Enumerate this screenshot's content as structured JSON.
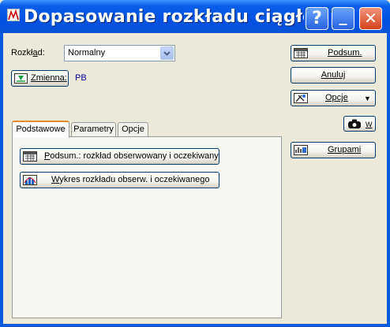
{
  "window": {
    "title": "Dopasowanie rozkładu ciągłego: /",
    "help_symbol": "?",
    "minimize_symbol": "_",
    "close_symbol": "✕"
  },
  "distribution": {
    "label_prefix": "Rozkł",
    "label_hotkey": "a",
    "label_suffix": "d:",
    "selected": "Normalny"
  },
  "variable": {
    "button_label": "Zmienna:",
    "value": "PB"
  },
  "tabs": [
    {
      "label": "Podstawowe"
    },
    {
      "label": "Parametry"
    },
    {
      "label": "Opcje"
    }
  ],
  "basic_tab": {
    "summary_hotkey": "P",
    "summary_rest": "odsum.: rozkład obserwowany i oczekiwany",
    "plot_hotkey": "W",
    "plot_rest": "ykres rozkładu obserw. i oczekiwanego"
  },
  "side_buttons": {
    "summary": "Podsum.",
    "cancel": "Anuluj",
    "options": "Opcje",
    "options_arrow": "▼",
    "w_label": "W",
    "groups": "Grupami"
  },
  "colors": {
    "title_bar": "#0054e3",
    "accent_link": "#0000a0"
  }
}
